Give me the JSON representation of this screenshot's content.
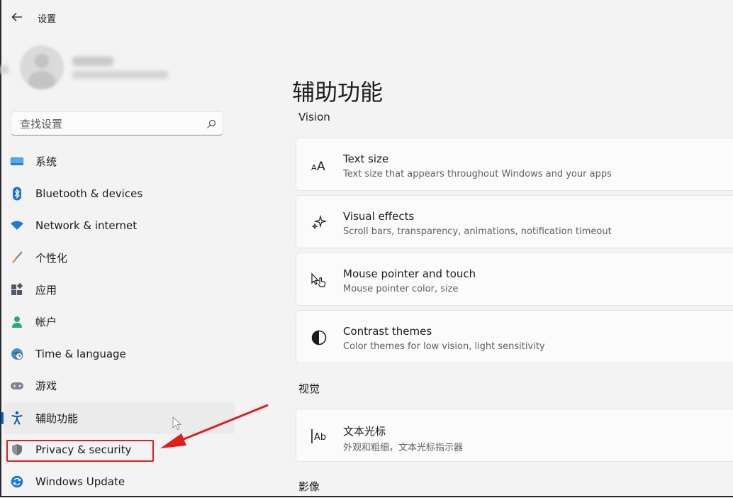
{
  "window": {
    "title": "设置"
  },
  "search": {
    "placeholder": "查找设置"
  },
  "sidebar": {
    "items": [
      {
        "label": "系统",
        "icon": "monitor-icon"
      },
      {
        "label": "Bluetooth & devices",
        "icon": "bluetooth-icon"
      },
      {
        "label": "Network & internet",
        "icon": "wifi-icon"
      },
      {
        "label": "个性化",
        "icon": "brush-icon"
      },
      {
        "label": "应用",
        "icon": "apps-icon"
      },
      {
        "label": "帐户",
        "icon": "account-icon"
      },
      {
        "label": "Time & language",
        "icon": "globe-clock-icon"
      },
      {
        "label": "游戏",
        "icon": "gamepad-icon"
      },
      {
        "label": "辅助功能",
        "icon": "accessibility-icon",
        "active": true
      },
      {
        "label": "Privacy & security",
        "icon": "shield-icon"
      },
      {
        "label": "Windows Update",
        "icon": "sync-icon"
      }
    ]
  },
  "main": {
    "title": "辅助功能",
    "sections": [
      {
        "label": "Vision",
        "cards": [
          {
            "title": "Text size",
            "subtitle": "Text size that appears throughout Windows and your apps",
            "icon": "text-size-icon"
          },
          {
            "title": "Visual effects",
            "subtitle": "Scroll bars, transparency, animations, notification timeout",
            "icon": "sparkle-icon"
          },
          {
            "title": "Mouse pointer and touch",
            "subtitle": "Mouse pointer color, size",
            "icon": "pointer-touch-icon"
          },
          {
            "title": "Contrast themes",
            "subtitle": "Color themes for low vision, light sensitivity",
            "icon": "contrast-icon"
          }
        ]
      },
      {
        "label": "视觉",
        "cards": [
          {
            "title": "文本光标",
            "subtitle": "外观和粗细，文本光标指示器",
            "icon": "text-cursor-icon"
          }
        ]
      },
      {
        "label": "影像",
        "cards": []
      }
    ]
  },
  "colors": {
    "accent": "#0067c0",
    "annotation": "#e41b1b",
    "background": "#f3f3f3",
    "card": "#fbfbfb"
  }
}
